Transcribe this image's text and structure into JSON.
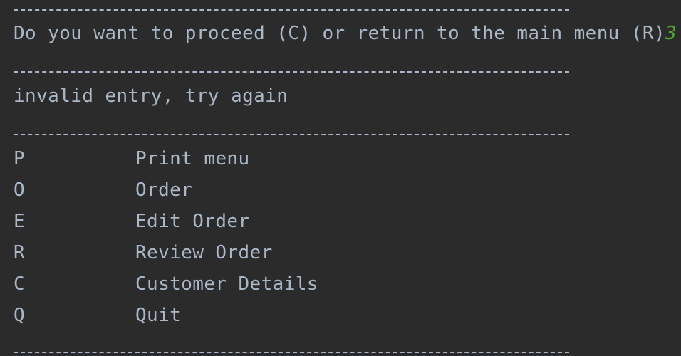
{
  "console": {
    "prompt": "Do you want to proceed (C) or return to the main menu (R)",
    "user_input": "3",
    "error_message": "invalid entry, try again",
    "menu": [
      {
        "key": "P",
        "label": "Print menu"
      },
      {
        "key": "O",
        "label": "Order"
      },
      {
        "key": "E",
        "label": "Edit Order"
      },
      {
        "key": "R",
        "label": "Review Order"
      },
      {
        "key": "C",
        "label": "Customer Details"
      },
      {
        "key": "Q",
        "label": "Quit"
      }
    ]
  },
  "colors": {
    "background": "#2b2b2b",
    "text": "#a9b7c6",
    "user_input": "#55a630"
  }
}
